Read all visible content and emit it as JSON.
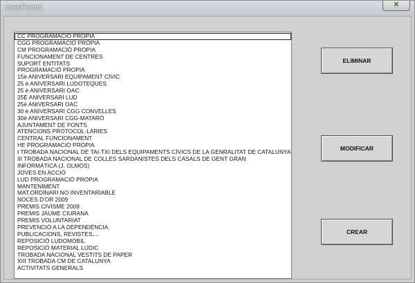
{
  "window": {
    "title": "UserForm1",
    "close_label": "✕"
  },
  "list": {
    "selected_index": 0,
    "items": [
      "CC PROGRAMACIÓ PRÒPIA",
      "CGG PROGRAMACIÓ PRÒPIA",
      "CM PROGRAMACIÓ PRÒPIA",
      "FUNCIONAMENT DE CENTRES",
      "SUPORT ENTITATS",
      "PROGRAMACIÓ PROPIA",
      "15è ANIVERSARI EQUIPAMENT CÍVIC",
      "25 è ANIVERSARI LUDOTEQUES",
      "25 è ANIVERSARI OAC",
      "25È ANIVERSARI LUD",
      "25è ANIVERSARI OAC",
      "30 è ANIVERSARI CGG CONVELLES",
      "30è ANIVERSARI CGG-MATARÓ",
      "AJUNTAMENT DE PONTS",
      "ATENCIONS PROTOCOL·LÀRIES",
      "CENTRAL FUNCIONAMENT",
      "HE PROGRAMACIÓ PRÒPIA",
      "I TROBADA NACIONAL DE TAI-TXI DELS EQUIPAMENTS CÍVICS DE LA GENRALITAT DE CATALUNYA",
      "III TROBADA NACIONAL DE COLLES SARDANISTES DELS CASALS DE GENT GRAN",
      "INFORMÀTICA (J. OLMOS)",
      "JOVES EN ACCIÓ",
      "LUD PROGRAMACIÓ PRÒPIA",
      "MANTENIMENT",
      "MAT.ORDINARI NO INVENTARIABLE",
      "NOCES D'OR 2009",
      "PREMIS CIVISME 2009",
      "PREMIS JAUME CIURANA",
      "PREMIS VOLUNTARIAT",
      "PREVENCIÓ A LA DEPENDÈNCIA",
      "PUBLICACIONS, REVISTES,...",
      "REPOSICIÓ LUDOMÒBIL",
      "REPOSICIÓ MATERIAL LÚDIC",
      "TROBADA NACIONAL VESTITS DE PAPER",
      "XIII TROBADA CM DE CATALUNYA",
      "ACTIVITATS GENERALS"
    ]
  },
  "buttons": {
    "eliminar": "ELIMINAR",
    "modificar": "MODIFICAR",
    "crear": "CREAR"
  }
}
